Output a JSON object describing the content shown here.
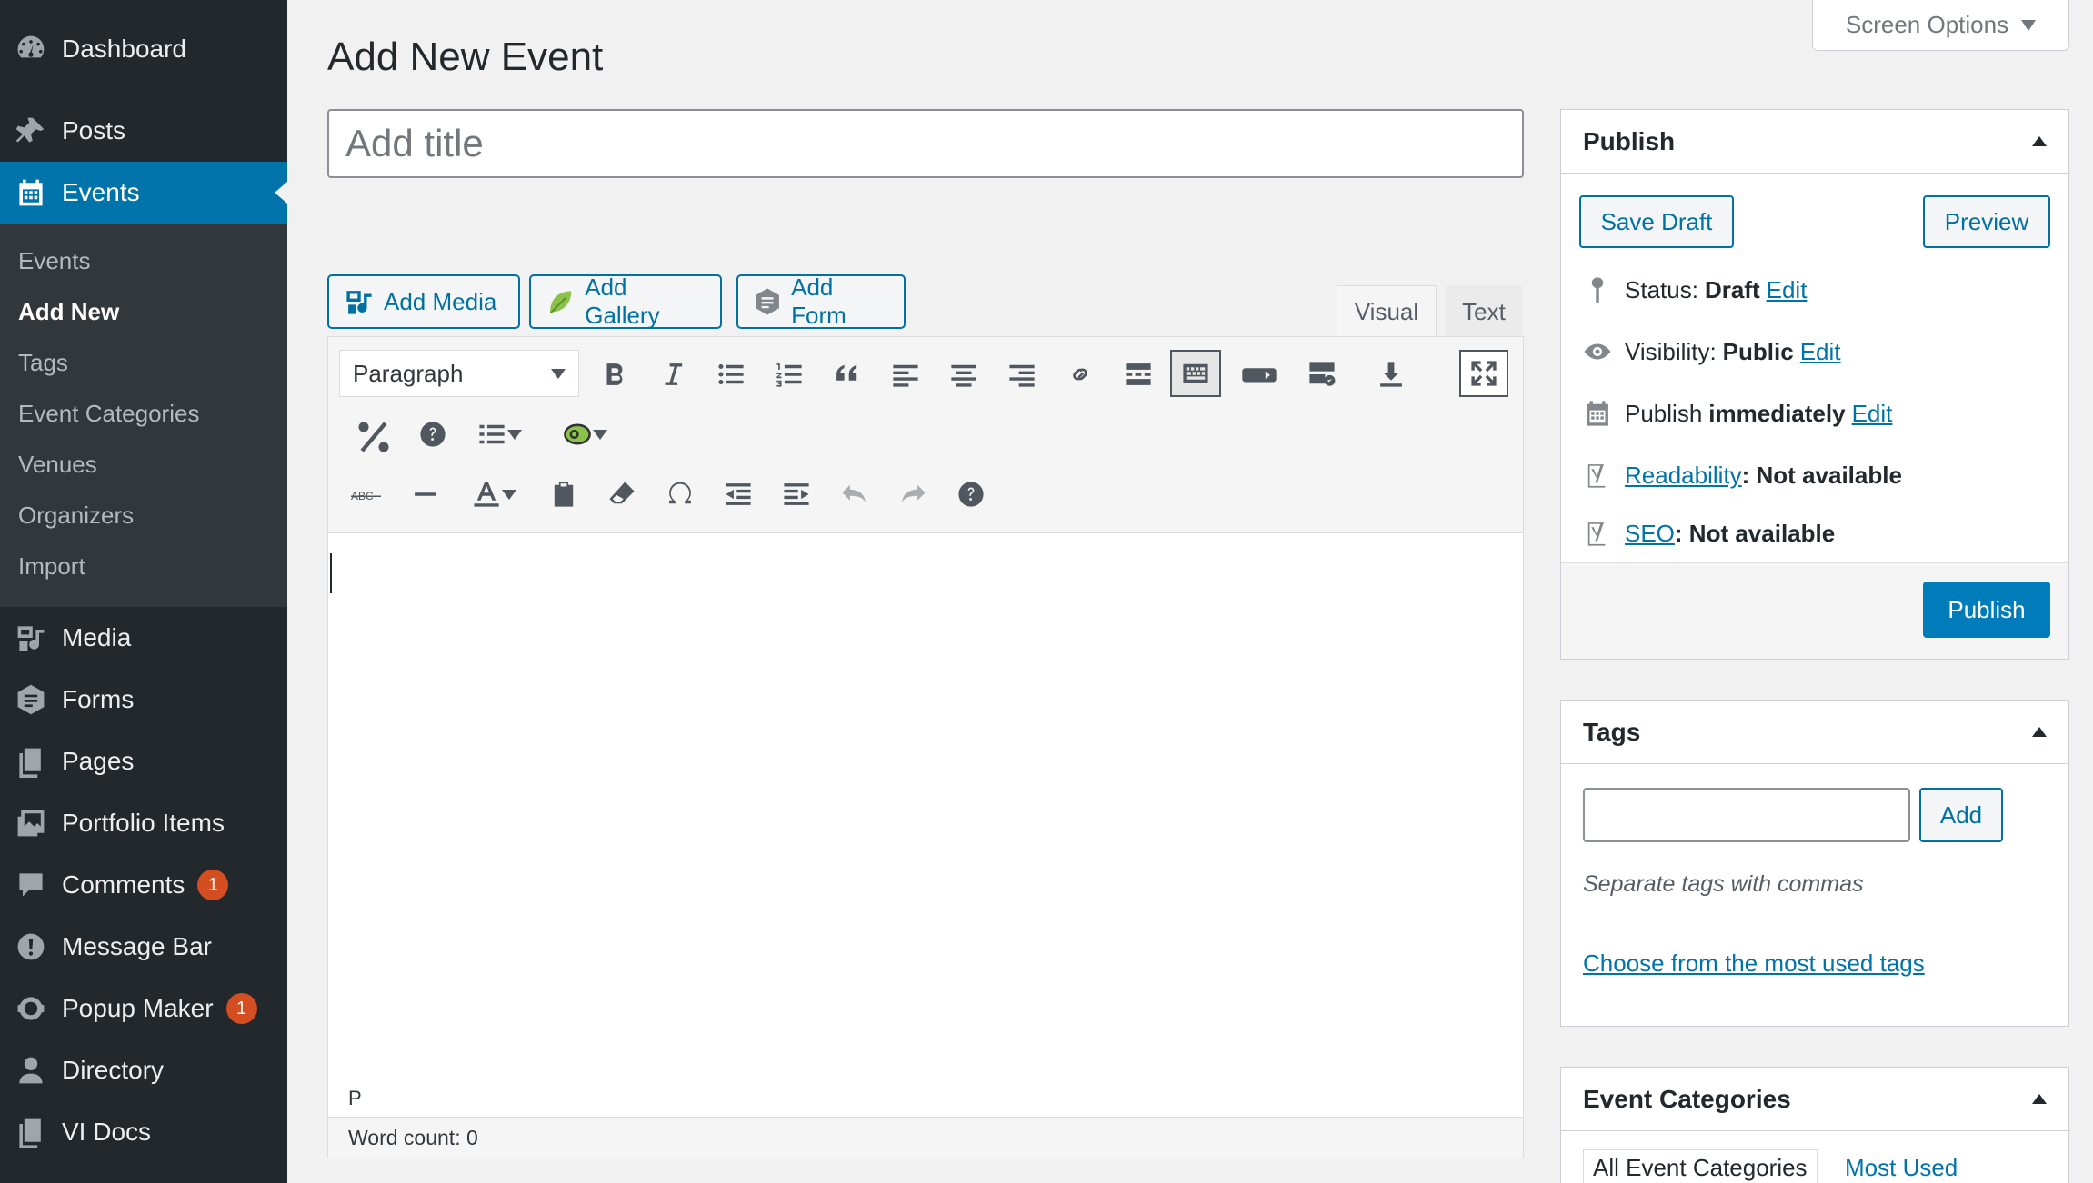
{
  "sidebar": {
    "menu": [
      {
        "label": "Dashboard",
        "icon": "dashboard-icon"
      },
      {
        "label": "Posts",
        "icon": "pin-icon"
      },
      {
        "label": "Events",
        "icon": "calendar-icon"
      },
      {
        "label": "Media",
        "icon": "media-icon"
      },
      {
        "label": "Forms",
        "icon": "forms-icon"
      },
      {
        "label": "Pages",
        "icon": "pages-icon"
      },
      {
        "label": "Portfolio Items",
        "icon": "portfolio-icon"
      },
      {
        "label": "Comments",
        "icon": "comment-icon",
        "badge": "1"
      },
      {
        "label": "Message Bar",
        "icon": "alert-icon"
      },
      {
        "label": "Popup Maker",
        "icon": "popup-icon",
        "badge": "1"
      },
      {
        "label": "Directory",
        "icon": "user-icon"
      },
      {
        "label": "VI Docs",
        "icon": "docs-icon"
      }
    ],
    "submenu": [
      "Events",
      "Add New",
      "Tags",
      "Event Categories",
      "Venues",
      "Organizers",
      "Import"
    ]
  },
  "screen_options": "Screen Options",
  "page_title": "Add New Event",
  "title_placeholder": "Add title",
  "media_buttons": {
    "add_media": "Add Media",
    "add_gallery": "Add Gallery",
    "add_form": "Add Form"
  },
  "editor": {
    "tab_visual": "Visual",
    "tab_text": "Text",
    "format_select": "Paragraph",
    "path": "P",
    "word_count": "Word count: 0"
  },
  "publish": {
    "title": "Publish",
    "save_draft": "Save Draft",
    "preview": "Preview",
    "status_label": "Status:",
    "status_value": "Draft",
    "visibility_label": "Visibility:",
    "visibility_value": "Public",
    "publish_label": "Publish",
    "publish_value": "immediately",
    "edit": "Edit",
    "readability_link": "Readability",
    "readability_value": ": Not available",
    "seo_link": "SEO",
    "seo_value": ": Not available",
    "publish_button": "Publish"
  },
  "tags": {
    "title": "Tags",
    "add_button": "Add",
    "hint": "Separate tags with commas",
    "choose_link": "Choose from the most used tags"
  },
  "event_categories": {
    "title": "Event Categories",
    "tab_all": "All Event Categories",
    "tab_most_used": "Most Used"
  },
  "colors": {
    "accent": "#0073aa",
    "sidebar_bg": "#23282d",
    "badge": "#d54e21"
  }
}
